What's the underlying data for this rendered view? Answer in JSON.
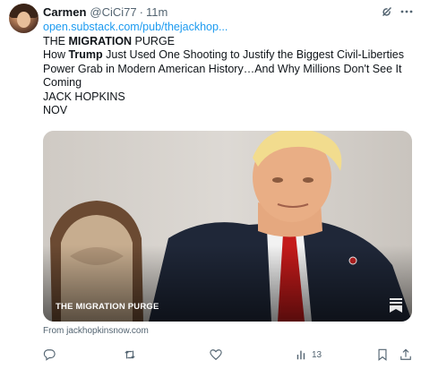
{
  "tweet": {
    "author_name": "Carmen",
    "author_handle": "@CiCi77",
    "separator": "·",
    "time": "11m",
    "link_text": "open.substack.com/pub/thejackhop...",
    "headline_prefix": "THE ",
    "headline_bold": "MIGRATION",
    "headline_suffix": " PURGE",
    "subtitle_prefix": "How ",
    "subtitle_bold": "Trump",
    "subtitle_suffix": " Just Used One Shooting to Justify the Biggest Civil-Liberties Power Grab in Modern American History…And Why Millions Don't See It Coming",
    "author_line": "JACK HOPKINS",
    "date_line": "NOV"
  },
  "card": {
    "title": "THE MIGRATION PURGE",
    "image_icon": "bookmark-logo-icon"
  },
  "source_text": "From jackhopkinsnow.com",
  "actions": {
    "reply_icon": "reply-icon",
    "retweet_icon": "retweet-icon",
    "like_icon": "heart-icon",
    "views_icon": "views-icon",
    "views_count": "13",
    "bookmark_icon": "bookmark-icon",
    "share_icon": "share-icon"
  },
  "colors": {
    "link": "#1d9bf0",
    "secondary_text": "#536471",
    "primary_text": "#0f1419"
  }
}
